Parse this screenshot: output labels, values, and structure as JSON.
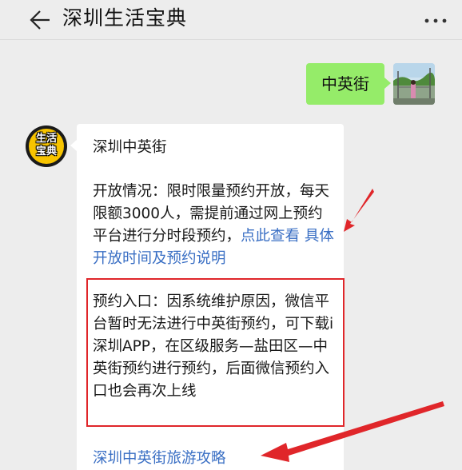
{
  "header": {
    "title": "深圳生活宝典",
    "back_icon": "arrow-left-icon",
    "more_icon": "more-dots-icon"
  },
  "outgoing": {
    "text": "中英街"
  },
  "bot": {
    "avatar_line1": "生活",
    "avatar_line2": "宝典",
    "heading": "深圳中英街",
    "open_status": "开放情况：限时限量预约开放，每天限额3000人，需提前通过网上预约平台进行分时段预约，",
    "link_view": "点此查看",
    "link_details": "具体开放时间及预约说明",
    "reservation": "预约入口：因系统维护原因，微信平台暂时无法进行中英街预约，可下载i深圳APP，在区级服务—盐田区—中英街预约进行预约，后面微信预约入口也会再次上线",
    "link_guide": "深圳中英街旅游攻略"
  },
  "colors": {
    "bubble_out": "#95ec69",
    "link": "#3a6fc4",
    "highlight_border": "#e0262a",
    "arrow": "#e0262a"
  }
}
